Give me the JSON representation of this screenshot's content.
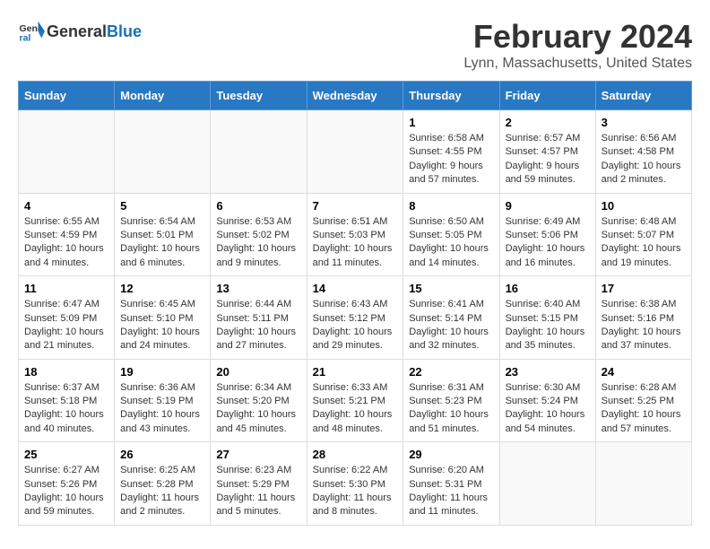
{
  "header": {
    "logo_general": "General",
    "logo_blue": "Blue",
    "title": "February 2024",
    "subtitle": "Lynn, Massachusetts, United States"
  },
  "weekdays": [
    "Sunday",
    "Monday",
    "Tuesday",
    "Wednesday",
    "Thursday",
    "Friday",
    "Saturday"
  ],
  "weeks": [
    [
      {
        "day": "",
        "empty": true
      },
      {
        "day": "",
        "empty": true
      },
      {
        "day": "",
        "empty": true
      },
      {
        "day": "",
        "empty": true
      },
      {
        "day": "1",
        "sunrise": "6:58 AM",
        "sunset": "4:55 PM",
        "daylight": "9 hours and 57 minutes."
      },
      {
        "day": "2",
        "sunrise": "6:57 AM",
        "sunset": "4:57 PM",
        "daylight": "9 hours and 59 minutes."
      },
      {
        "day": "3",
        "sunrise": "6:56 AM",
        "sunset": "4:58 PM",
        "daylight": "10 hours and 2 minutes."
      }
    ],
    [
      {
        "day": "4",
        "sunrise": "6:55 AM",
        "sunset": "4:59 PM",
        "daylight": "10 hours and 4 minutes."
      },
      {
        "day": "5",
        "sunrise": "6:54 AM",
        "sunset": "5:01 PM",
        "daylight": "10 hours and 6 minutes."
      },
      {
        "day": "6",
        "sunrise": "6:53 AM",
        "sunset": "5:02 PM",
        "daylight": "10 hours and 9 minutes."
      },
      {
        "day": "7",
        "sunrise": "6:51 AM",
        "sunset": "5:03 PM",
        "daylight": "10 hours and 11 minutes."
      },
      {
        "day": "8",
        "sunrise": "6:50 AM",
        "sunset": "5:05 PM",
        "daylight": "10 hours and 14 minutes."
      },
      {
        "day": "9",
        "sunrise": "6:49 AM",
        "sunset": "5:06 PM",
        "daylight": "10 hours and 16 minutes."
      },
      {
        "day": "10",
        "sunrise": "6:48 AM",
        "sunset": "5:07 PM",
        "daylight": "10 hours and 19 minutes."
      }
    ],
    [
      {
        "day": "11",
        "sunrise": "6:47 AM",
        "sunset": "5:09 PM",
        "daylight": "10 hours and 21 minutes."
      },
      {
        "day": "12",
        "sunrise": "6:45 AM",
        "sunset": "5:10 PM",
        "daylight": "10 hours and 24 minutes."
      },
      {
        "day": "13",
        "sunrise": "6:44 AM",
        "sunset": "5:11 PM",
        "daylight": "10 hours and 27 minutes."
      },
      {
        "day": "14",
        "sunrise": "6:43 AM",
        "sunset": "5:12 PM",
        "daylight": "10 hours and 29 minutes."
      },
      {
        "day": "15",
        "sunrise": "6:41 AM",
        "sunset": "5:14 PM",
        "daylight": "10 hours and 32 minutes."
      },
      {
        "day": "16",
        "sunrise": "6:40 AM",
        "sunset": "5:15 PM",
        "daylight": "10 hours and 35 minutes."
      },
      {
        "day": "17",
        "sunrise": "6:38 AM",
        "sunset": "5:16 PM",
        "daylight": "10 hours and 37 minutes."
      }
    ],
    [
      {
        "day": "18",
        "sunrise": "6:37 AM",
        "sunset": "5:18 PM",
        "daylight": "10 hours and 40 minutes."
      },
      {
        "day": "19",
        "sunrise": "6:36 AM",
        "sunset": "5:19 PM",
        "daylight": "10 hours and 43 minutes."
      },
      {
        "day": "20",
        "sunrise": "6:34 AM",
        "sunset": "5:20 PM",
        "daylight": "10 hours and 45 minutes."
      },
      {
        "day": "21",
        "sunrise": "6:33 AM",
        "sunset": "5:21 PM",
        "daylight": "10 hours and 48 minutes."
      },
      {
        "day": "22",
        "sunrise": "6:31 AM",
        "sunset": "5:23 PM",
        "daylight": "10 hours and 51 minutes."
      },
      {
        "day": "23",
        "sunrise": "6:30 AM",
        "sunset": "5:24 PM",
        "daylight": "10 hours and 54 minutes."
      },
      {
        "day": "24",
        "sunrise": "6:28 AM",
        "sunset": "5:25 PM",
        "daylight": "10 hours and 57 minutes."
      }
    ],
    [
      {
        "day": "25",
        "sunrise": "6:27 AM",
        "sunset": "5:26 PM",
        "daylight": "10 hours and 59 minutes."
      },
      {
        "day": "26",
        "sunrise": "6:25 AM",
        "sunset": "5:28 PM",
        "daylight": "11 hours and 2 minutes."
      },
      {
        "day": "27",
        "sunrise": "6:23 AM",
        "sunset": "5:29 PM",
        "daylight": "11 hours and 5 minutes."
      },
      {
        "day": "28",
        "sunrise": "6:22 AM",
        "sunset": "5:30 PM",
        "daylight": "11 hours and 8 minutes."
      },
      {
        "day": "29",
        "sunrise": "6:20 AM",
        "sunset": "5:31 PM",
        "daylight": "11 hours and 11 minutes."
      },
      {
        "day": "",
        "empty": true
      },
      {
        "day": "",
        "empty": true
      }
    ]
  ]
}
